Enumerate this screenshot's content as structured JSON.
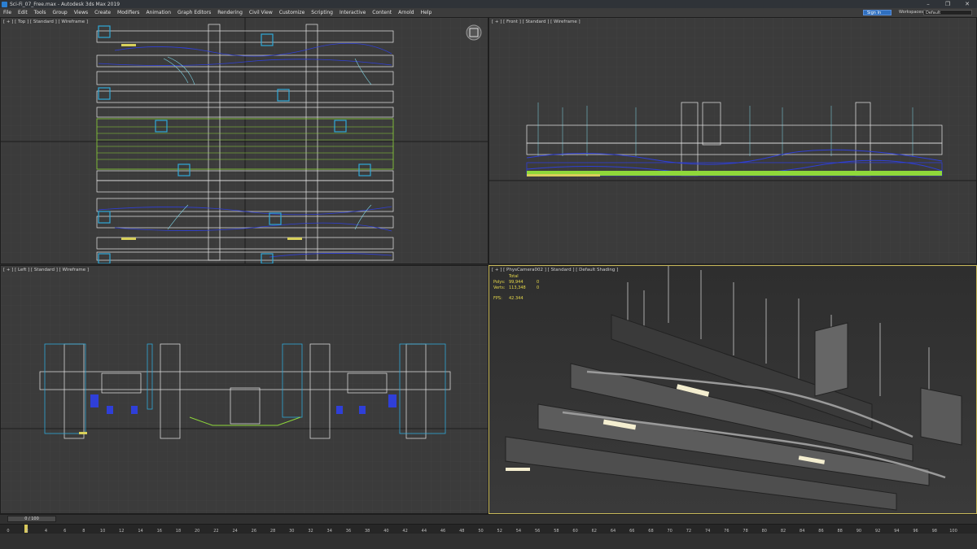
{
  "window": {
    "title": "Sci-Fi_07_Free.max - Autodesk 3ds Max 2019",
    "controls": [
      "–",
      "❐",
      "✕"
    ]
  },
  "menu": [
    "File",
    "Edit",
    "Tools",
    "Group",
    "Views",
    "Create",
    "Modifiers",
    "Animation",
    "Graph Editors",
    "Rendering",
    "Civil View",
    "Customize",
    "Scripting",
    "Interactive",
    "Content",
    "Arnold",
    "Help"
  ],
  "account": {
    "sign_in": "Sign In",
    "workspaces_label": "Workspaces:",
    "workspace_value": "Default"
  },
  "viewports": {
    "top": {
      "label": "[ + ] [ Top ] [ Standard ] [ Wireframe ]"
    },
    "front": {
      "label": "[ + ] [ Front ] [ Standard ] [ Wireframe ]"
    },
    "left": {
      "label": "[ + ] [ Left ] [ Standard ] [ Wireframe ]"
    },
    "camera": {
      "label": "[ + ] [ PhysCamera002 ] [ Standard ] [ Default Shading ]",
      "stats": {
        "total_header": "Total",
        "polys_label": "Polys:",
        "polys_total": "99,944",
        "polys_sel": "0",
        "verts_label": "Verts:",
        "verts_total": "113,348",
        "verts_sel": "0",
        "fps_label": "FPS:",
        "fps_value": "42.344"
      }
    }
  },
  "timeline": {
    "frame_display": "0 / 100",
    "ticks": [
      "0",
      "2",
      "4",
      "6",
      "8",
      "10",
      "12",
      "14",
      "16",
      "18",
      "20",
      "22",
      "24",
      "26",
      "28",
      "30",
      "32",
      "34",
      "36",
      "38",
      "40",
      "42",
      "44",
      "46",
      "48",
      "50",
      "52",
      "54",
      "56",
      "58",
      "60",
      "62",
      "64",
      "66",
      "68",
      "70",
      "72",
      "74",
      "76",
      "78",
      "80",
      "82",
      "84",
      "86",
      "88",
      "90",
      "92",
      "94",
      "96",
      "98",
      "100"
    ]
  },
  "colors": {
    "accent_active": "#c8b95a",
    "wire_cyan": "#7fd8e8",
    "wire_green": "#8fd83a",
    "wire_blue": "#2f3fd8",
    "wire_white": "#e8e8e8"
  }
}
